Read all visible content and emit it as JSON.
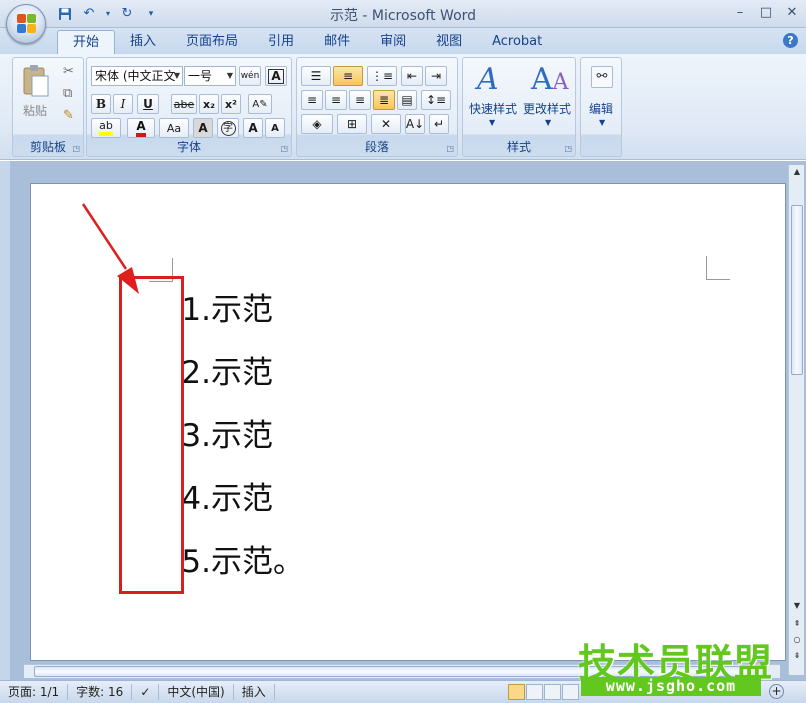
{
  "window": {
    "title": "示范 - Microsoft Word",
    "controls": [
      "–",
      "□",
      "✕"
    ]
  },
  "quick_access": [
    "save-icon",
    "undo-icon",
    "redo-icon",
    "customize-icon"
  ],
  "tabs": [
    {
      "label": "开始",
      "active": true
    },
    {
      "label": "插入"
    },
    {
      "label": "页面布局"
    },
    {
      "label": "引用"
    },
    {
      "label": "邮件"
    },
    {
      "label": "审阅"
    },
    {
      "label": "视图"
    },
    {
      "label": "Acrobat"
    }
  ],
  "help_label": "?",
  "ribbon": {
    "clipboard": {
      "label": "剪贴板",
      "paste_label": "粘贴"
    },
    "font": {
      "label": "字体",
      "font_name": "宋体 (中文正文",
      "font_size": "一号",
      "wen_label": "wén\n变",
      "bold": "B",
      "italic": "I",
      "underline": "U",
      "strike": "abe",
      "subscript": "x₂",
      "superscript": "x²",
      "grow": "A",
      "shrink": "A",
      "case": "Aa",
      "color_a": "A"
    },
    "paragraph": {
      "label": "段落"
    },
    "styles": {
      "label": "样式",
      "quick_styles": "快速样式",
      "change_styles": "更改样式"
    },
    "editing": {
      "label": "编辑"
    }
  },
  "document": {
    "items": [
      {
        "num": "1.",
        "text": "示范"
      },
      {
        "num": "2.",
        "text": "示范"
      },
      {
        "num": "3.",
        "text": "示范"
      },
      {
        "num": "4.",
        "text": "示范"
      },
      {
        "num": "5.",
        "text": "示范。"
      }
    ],
    "annotation_color": "#d62020"
  },
  "statusbar": {
    "page": "页面: 1/1",
    "words": "字数: 16",
    "language": "中文(中国)",
    "mode": "插入"
  },
  "watermark": {
    "title": "技术员联盟",
    "url": "www.jsgho.com"
  }
}
